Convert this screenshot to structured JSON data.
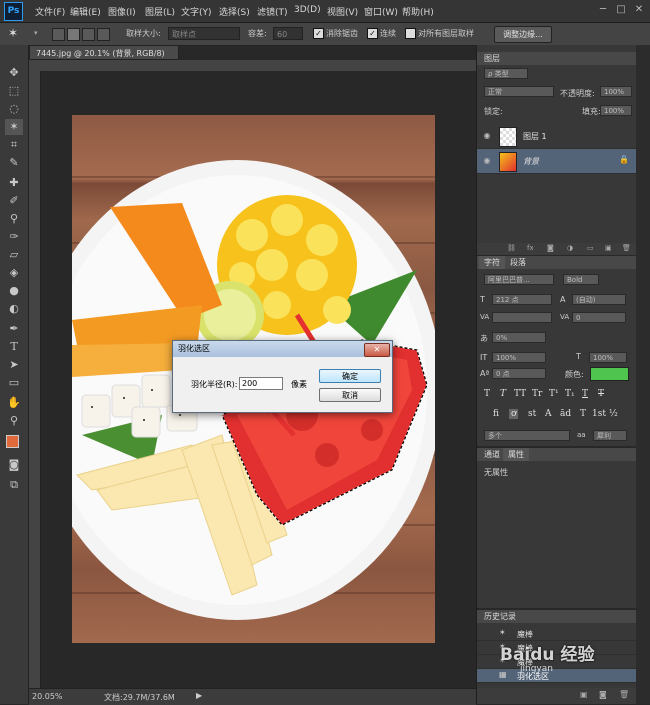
{
  "app": {
    "logo": "Ps"
  },
  "menu": [
    "文件(F)",
    "编辑(E)",
    "图像(I)",
    "图层(L)",
    "文字(Y)",
    "选择(S)",
    "滤镜(T)",
    "3D(D)",
    "视图(V)",
    "窗口(W)",
    "帮助(H)"
  ],
  "window_buttons": [
    "─",
    "□",
    "✕"
  ],
  "options": {
    "sample_size_label": "取样大小:",
    "sample_size_value": "取样点",
    "tolerance_label": "容差:",
    "tolerance_value": "60",
    "antialias_label": "消除锯齿",
    "contiguous_label": "连续",
    "all_layers_label": "对所有图层取样",
    "refine_edge": "调整边缘..."
  },
  "document": {
    "tab": "7445.jpg @ 20.1% (背景, RGB/8) *",
    "zoom": "20.05%",
    "doc_size": "文档:29.7M/37.6M"
  },
  "dialog": {
    "title": "羽化选区",
    "radius_label": "羽化半径(R):",
    "radius_value": "200",
    "unit": "像素",
    "ok": "确定",
    "cancel": "取消",
    "close": "✕"
  },
  "layers_panel": {
    "tab": "图层",
    "filter_kind": "ρ 类型",
    "blend_mode": "正常",
    "opacity_label": "不透明度:",
    "opacity_value": "100%",
    "lock_label": "锁定:",
    "fill_label": "填充:",
    "fill_value": "100%",
    "layers": [
      {
        "name": "图层 1"
      },
      {
        "name": "背景"
      }
    ]
  },
  "character_panel": {
    "tabs": [
      "字符",
      "段落"
    ],
    "font_family": "阿里巴巴普...",
    "font_style": "Bold",
    "size": "212 点",
    "leading": "(自动)",
    "tracking_auto": "VA",
    "kerning_value": "0",
    "scale_percent": "0%",
    "vscale": "100%",
    "hscale": "100%",
    "baseline": "0 点",
    "color_label": "颜色:",
    "color_hex": "#4fc54f",
    "text_buttons": [
      "T",
      "T",
      "TT",
      "Tr",
      "T¹",
      "T₁",
      "T",
      "T"
    ],
    "extra_buttons": [
      "fi",
      "ơ",
      "st",
      "A",
      "ād",
      "T",
      "1st",
      "½"
    ],
    "language": "美国英语",
    "language_visible": "多个",
    "antialias": "犀利",
    "aa": "aa"
  },
  "properties_panel": {
    "tabs": [
      "通道",
      "属性"
    ],
    "content": "无属性"
  },
  "history_panel": {
    "tab": "历史记录",
    "items": [
      {
        "label": "魔棒"
      },
      {
        "label": "魔棒"
      },
      {
        "label": "魔棒"
      },
      {
        "label": "羽化选区"
      }
    ]
  },
  "watermark": "Baidu 经验",
  "watermark_sub": "jingyan"
}
